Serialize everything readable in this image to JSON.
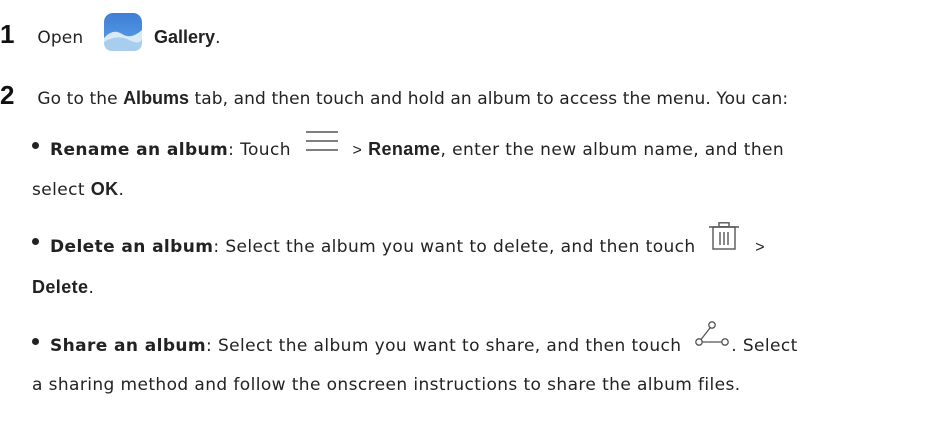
{
  "step1": {
    "number": "1",
    "text": "Open",
    "app_name": "Gallery",
    "suffix": ".",
    "icon": "gallery-app-icon"
  },
  "step2": {
    "number": "2",
    "text_before": "Go to the",
    "tab_name": "Albums",
    "text_after": "tab, and then touch and hold an album to access the menu. You can:"
  },
  "bullets": [
    {
      "title": "Rename an album",
      "colon": ":",
      "before_icon": "Touch",
      "icon": "menu-icon",
      "gt": ">",
      "action": "Rename",
      "after_action": ", enter the new album name, and then",
      "line2_prefix": "select",
      "line2_bold": "OK",
      "line2_suffix": "."
    },
    {
      "title": "Delete an album",
      "colon": ":",
      "text": "Select the album you want to delete, and then touch",
      "icon": "trash-icon",
      "gt": ">",
      "line2_bold": "Delete",
      "line2_suffix": "."
    },
    {
      "title": "Share an album",
      "colon": ":",
      "text": "Select the album you want to share, and then touch",
      "icon": "share-icon",
      "after_icon": ". Select",
      "line2": "a sharing method and follow the onscreen instructions to share the album files."
    }
  ]
}
